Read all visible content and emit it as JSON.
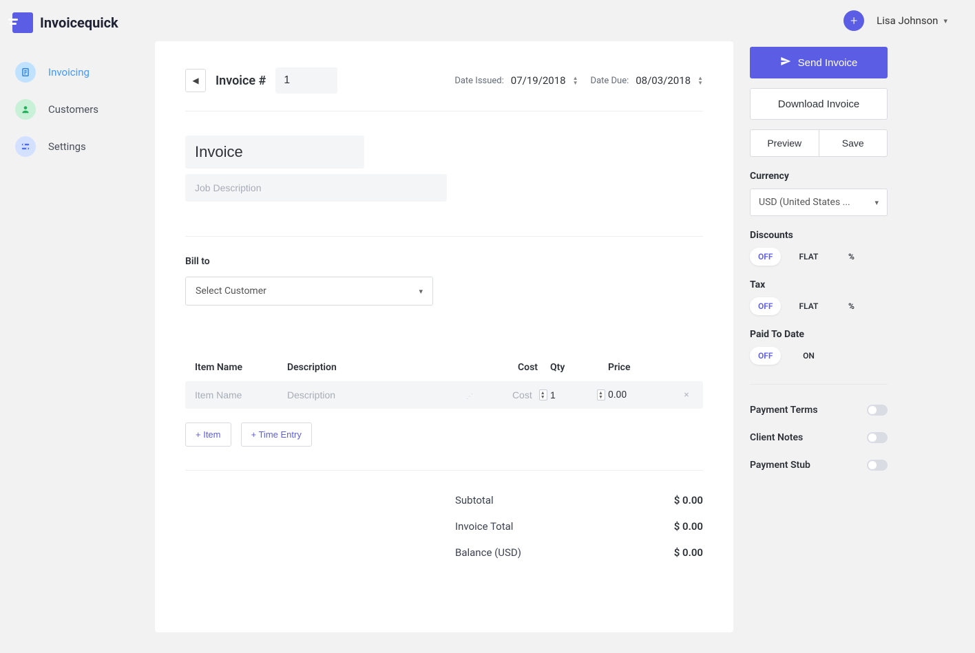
{
  "brand": {
    "name": "Invoicequick"
  },
  "nav": {
    "items": [
      {
        "label": "Invoicing"
      },
      {
        "label": "Customers"
      },
      {
        "label": "Settings"
      }
    ]
  },
  "topbar": {
    "user_name": "Lisa Johnson"
  },
  "invoice": {
    "number_label": "Invoice #",
    "number_value": "1",
    "date_issued_label": "Date Issued:",
    "date_issued_value": "07/19/2018",
    "date_due_label": "Date Due:",
    "date_due_value": "08/03/2018",
    "title_value": "Invoice",
    "desc_placeholder": "Job Description",
    "bill_to_label": "Bill to",
    "customer_placeholder": "Select Customer"
  },
  "items_table": {
    "headers": {
      "name": "Item Name",
      "desc": "Description",
      "cost": "Cost",
      "qty": "Qty",
      "price": "Price"
    },
    "row": {
      "name_placeholder": "Item Name",
      "desc_placeholder": "Description",
      "cost_placeholder": "Cost",
      "qty_value": "1",
      "price_value": "0.00"
    },
    "add_item_label": "+ Item",
    "add_time_label": "+ Time Entry"
  },
  "totals": {
    "subtotal_label": "Subtotal",
    "subtotal_value": "$ 0.00",
    "total_label": "Invoice Total",
    "total_value": "$ 0.00",
    "balance_label": "Balance (USD)",
    "balance_value": "$ 0.00"
  },
  "rpanel": {
    "send_label": "Send Invoice",
    "download_label": "Download Invoice",
    "preview_label": "Preview",
    "save_label": "Save",
    "currency_heading": "Currency",
    "currency_value": "USD (United States ...",
    "discounts_heading": "Discounts",
    "tax_heading": "Tax",
    "paid_heading": "Paid To Date",
    "seg_off": "OFF",
    "seg_flat": "FLAT",
    "seg_pct": "%",
    "seg_on": "ON",
    "toggle_payment_terms": "Payment Terms",
    "toggle_client_notes": "Client Notes",
    "toggle_payment_stub": "Payment Stub"
  }
}
